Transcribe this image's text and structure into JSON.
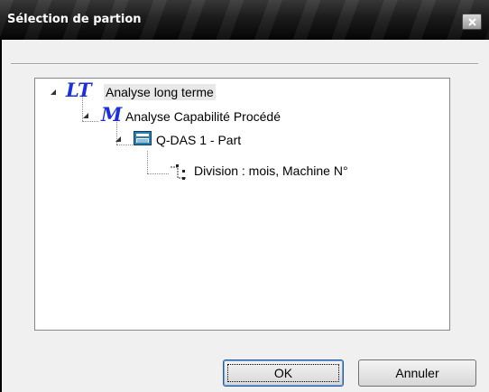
{
  "window": {
    "title": "Sélection de partion"
  },
  "tree": {
    "nodes": [
      {
        "level": 0,
        "icon": "lt-icon",
        "icon_text": "LT",
        "label": "Analyse long terme",
        "expanded": true,
        "selected": true
      },
      {
        "level": 1,
        "icon": "m-icon",
        "icon_text": "M",
        "label": "Analyse Capabilité Procédé",
        "expanded": true,
        "selected": false
      },
      {
        "level": 2,
        "icon": "part-database-icon",
        "label": "Q-DAS 1 - Part",
        "expanded": true,
        "selected": false
      },
      {
        "level": 3,
        "icon": "division-icon",
        "label": "Division : mois, Machine N°",
        "expanded": false,
        "selected": false
      }
    ]
  },
  "buttons": {
    "ok_label": "OK",
    "cancel_label": "Annuler"
  },
  "colors": {
    "accent": "#1c2fe0",
    "titlebar": "#1c1c1c"
  }
}
